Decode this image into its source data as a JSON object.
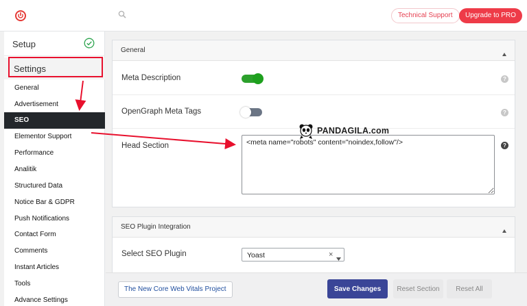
{
  "colors": {
    "accent": "#ee3b48",
    "annotation": "#e8102d",
    "active_nav": "#23272b",
    "primary_button": "#3a4597"
  },
  "header": {
    "logo_icon": "power-icon",
    "search_icon": "search-icon",
    "technical_support": "Technical Support",
    "upgrade": "Upgrade to PRO"
  },
  "sidebar": {
    "setup_label": "Setup",
    "setup_status_icon": "check-circle-icon",
    "settings_label": "Settings",
    "items": [
      {
        "label": "General"
      },
      {
        "label": "Advertisement"
      },
      {
        "label": "SEO",
        "active": true
      },
      {
        "label": "Elementor Support"
      },
      {
        "label": "Performance"
      },
      {
        "label": "Analitik"
      },
      {
        "label": "Structured Data"
      },
      {
        "label": "Notice Bar & GDPR"
      },
      {
        "label": "Push Notifications"
      },
      {
        "label": "Contact Form"
      },
      {
        "label": "Comments"
      },
      {
        "label": "Instant Articles"
      },
      {
        "label": "Tools"
      },
      {
        "label": "Advance Settings"
      }
    ]
  },
  "general_panel": {
    "title": "General",
    "meta_description": {
      "label": "Meta Description",
      "enabled": true
    },
    "opengraph": {
      "label": "OpenGraph Meta Tags",
      "enabled": false
    },
    "head_section": {
      "label": "Head Section",
      "value": "<meta name=\"robots\" content=\"noindex,follow\"/>"
    },
    "help_glyph": "?"
  },
  "seo_panel": {
    "title": "SEO Plugin Integration",
    "select_label": "Select SEO Plugin",
    "selected": "Yoast",
    "clear_glyph": "×"
  },
  "footer": {
    "cwv_link": "The New Core Web Vitals Project",
    "save": "Save Changes",
    "reset_section": "Reset Section",
    "reset_all": "Reset All"
  },
  "watermark": {
    "text": "PANDAGILA.com"
  }
}
